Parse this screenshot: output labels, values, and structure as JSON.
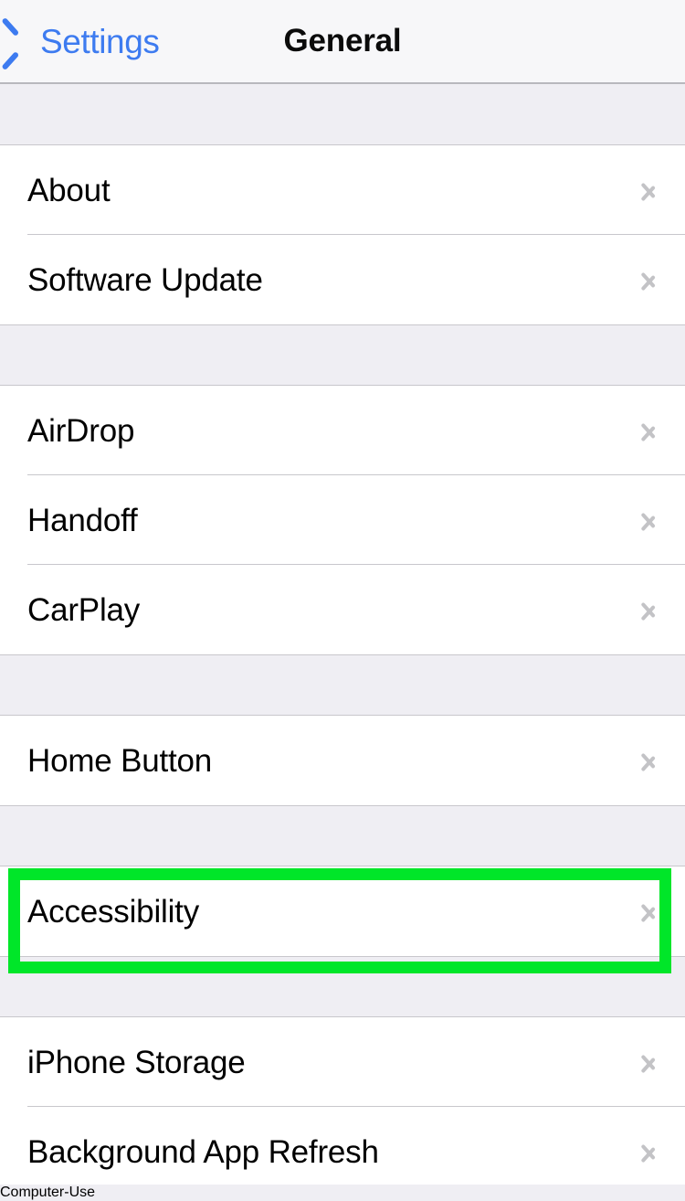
{
  "navbar": {
    "back_label": "Settings",
    "back_icon": "chevron-left-icon",
    "title": "General"
  },
  "colors": {
    "accent_blue": "#3d7bf0",
    "highlight_green": "#00e629",
    "group_background": "#efeef3",
    "row_background": "#ffffff",
    "separator": "#c8c7cc",
    "chevron_gray": "#c3c3c6"
  },
  "highlight": {
    "target": "Accessibility",
    "color": "#00e629"
  },
  "sections": [
    {
      "id": "section-device-info",
      "rows": [
        {
          "label": "About",
          "accessory": "chevron-right-icon"
        },
        {
          "label": "Software Update",
          "accessory": "chevron-right-icon"
        }
      ]
    },
    {
      "id": "section-connectivity",
      "rows": [
        {
          "label": "AirDrop",
          "accessory": "chevron-right-icon"
        },
        {
          "label": "Handoff",
          "accessory": "chevron-right-icon"
        },
        {
          "label": "CarPlay",
          "accessory": "chevron-right-icon"
        }
      ]
    },
    {
      "id": "section-home-button",
      "rows": [
        {
          "label": "Home Button",
          "accessory": "chevron-right-icon"
        }
      ]
    },
    {
      "id": "section-accessibility",
      "rows": [
        {
          "label": "Accessibility",
          "accessory": "chevron-right-icon"
        }
      ]
    },
    {
      "id": "section-storage",
      "rows": [
        {
          "label": "iPhone Storage",
          "accessory": "chevron-right-icon"
        },
        {
          "label": "Background App Refresh",
          "accessory": "chevron-right-icon"
        }
      ]
    }
  ]
}
